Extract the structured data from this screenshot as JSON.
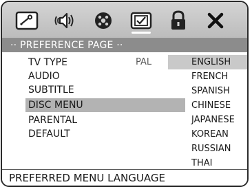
{
  "tabs": [
    {
      "icon": "general-setup-icon",
      "active": false
    },
    {
      "icon": "audio-setup-icon",
      "active": false
    },
    {
      "icon": "video-setup-icon",
      "active": false
    },
    {
      "icon": "preference-icon",
      "active": true
    },
    {
      "icon": "password-lock-icon",
      "active": false
    },
    {
      "icon": "close-icon",
      "active": false
    }
  ],
  "page_title": "·· PREFERENCE PAGE ··",
  "menu": {
    "items": [
      {
        "label": "TV TYPE",
        "value": "PAL"
      },
      {
        "label": "AUDIO",
        "value": ""
      },
      {
        "label": "SUBTITLE",
        "value": ""
      },
      {
        "label": "DISC MENU",
        "value": "",
        "selected": true
      },
      {
        "label": "PARENTAL",
        "value": ""
      },
      {
        "label": "DEFAULT",
        "value": ""
      }
    ]
  },
  "options": [
    {
      "label": "ENGLISH",
      "highlighted": true
    },
    {
      "label": "FRENCH",
      "highlighted": false
    },
    {
      "label": "SPANISH",
      "highlighted": false
    },
    {
      "label": "CHINESE",
      "highlighted": false
    },
    {
      "label": "JAPANESE",
      "highlighted": false
    },
    {
      "label": "KOREAN",
      "highlighted": false
    },
    {
      "label": "RUSSIAN",
      "highlighted": false
    },
    {
      "label": "THAI",
      "highlighted": false
    }
  ],
  "footer_text": "PREFERRED MENU LANGUAGE",
  "colors": {
    "tabbar": "#c8c8c8",
    "pagebar": "#8c8c8c",
    "selection": "#b3b3b3",
    "option_highlight": "#c9c9c9"
  }
}
